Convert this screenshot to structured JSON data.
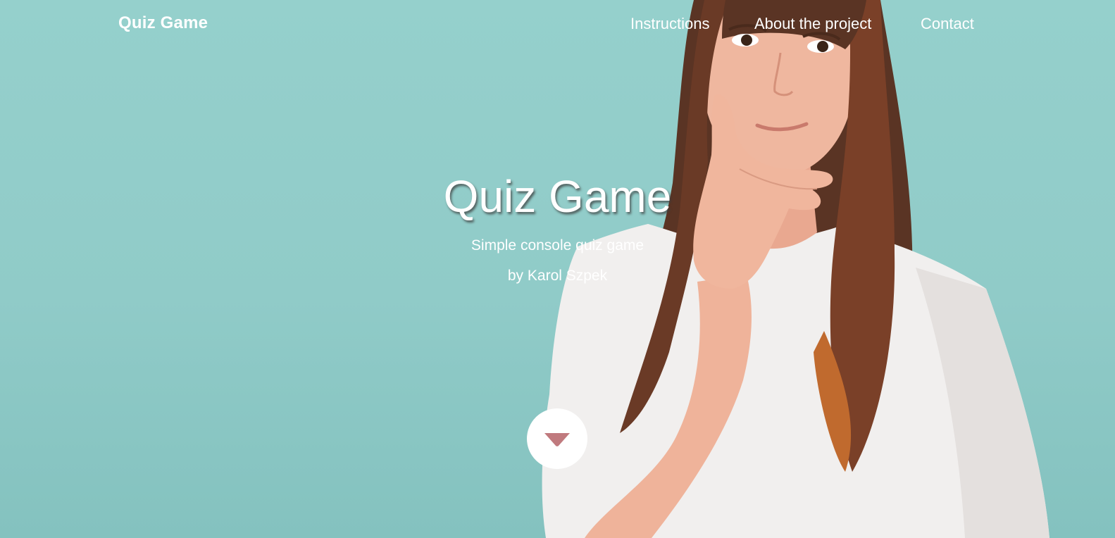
{
  "navbar": {
    "brand": "Quiz Game",
    "links": [
      {
        "label": "Instructions"
      },
      {
        "label": "About the project"
      },
      {
        "label": "Contact"
      }
    ]
  },
  "hero": {
    "title": "Quiz Game",
    "subtitle": "Simple console quiz game",
    "author": "by Karol Szpek",
    "background_color": "#90cbc8",
    "scroll_button": {
      "icon": "caret-down-icon",
      "icon_color": "#c07a7e",
      "background": "#ffffff"
    },
    "image": {
      "subject": "woman-thinking-photo"
    }
  }
}
